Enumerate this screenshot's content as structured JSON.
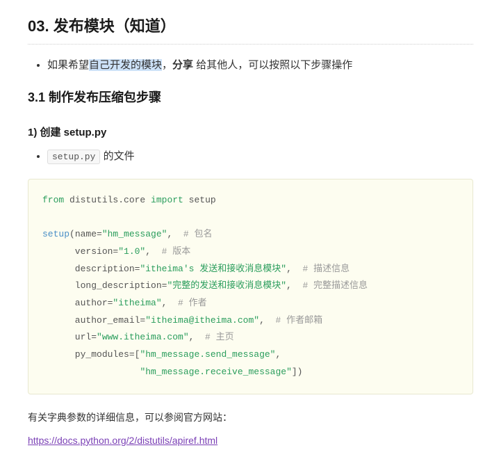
{
  "heading": "03. 发布模块（知道）",
  "intro": {
    "pre": "如果希望",
    "highlighted": "自己开发的模块",
    "mid": "，",
    "bold": "分享",
    "post": " 给其他人，可以按照以下步骤操作"
  },
  "section_title": "3.1 制作发布压缩包步骤",
  "step1_title": "1) 创建 setup.py",
  "step1_bullet": {
    "code": "setup.py",
    "suffix": " 的文件"
  },
  "code": {
    "l1_from": "from",
    "l1_mod": " distutils.core ",
    "l1_import": "import",
    "l1_target": " setup",
    "l2_fn": "setup",
    "l2_open": "(name=",
    "l2_name": "\"hm_message\"",
    "l2_close": ",  ",
    "l2_cm": "# 包名",
    "l3_indent": "      version=",
    "l3_val": "\"1.0\"",
    "l3_close": ",  ",
    "l3_cm": "# 版本",
    "l4_indent": "      description=",
    "l4_val": "\"itheima's 发送和接收消息模块\"",
    "l4_close": ",  ",
    "l4_cm": "# 描述信息",
    "l5_indent": "      long_description=",
    "l5_val": "\"完整的发送和接收消息模块\"",
    "l5_close": ",  ",
    "l5_cm": "# 完整描述信息",
    "l6_indent": "      author=",
    "l6_val": "\"itheima\"",
    "l6_close": ",  ",
    "l6_cm": "# 作者",
    "l7_indent": "      author_email=",
    "l7_val": "\"itheima@itheima.com\"",
    "l7_close": ",  ",
    "l7_cm": "# 作者邮箱",
    "l8_indent": "      url=",
    "l8_val": "\"www.itheima.com\"",
    "l8_close": ",  ",
    "l8_cm": "# 主页",
    "l9_indent": "      py_modules=[",
    "l9_val": "\"hm_message.send_message\"",
    "l9_close": ",",
    "l10_indent": "                  ",
    "l10_val": "\"hm_message.receive_message\"",
    "l10_close": "])"
  },
  "footer_text": "有关字典参数的详细信息，可以参阅官方网站：",
  "footer_link": "https://docs.python.org/2/distutils/apiref.html"
}
